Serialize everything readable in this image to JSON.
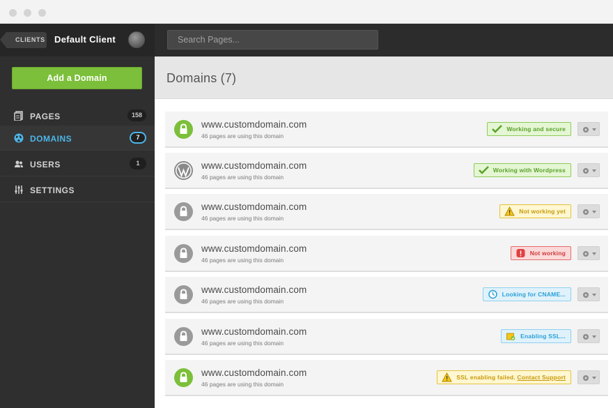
{
  "sidebar": {
    "back_label": "CLIENTS",
    "client_name": "Default Client",
    "add_domain_label": "Add a Domain",
    "nav": [
      {
        "label": "PAGES",
        "count": "158",
        "icon": "pages-icon"
      },
      {
        "label": "DOMAINS",
        "count": "7",
        "icon": "globe-icon"
      },
      {
        "label": "USERS",
        "count": "1",
        "icon": "users-icon"
      },
      {
        "label": "SETTINGS",
        "count": "",
        "icon": "sliders-icon"
      }
    ]
  },
  "topbar": {
    "search_placeholder": "Search Pages..."
  },
  "main": {
    "title": "Domains (7)",
    "domains": [
      {
        "name": "www.customdomain.com",
        "sub": "46 pages are using this domain",
        "icon": "lock-icon",
        "icon_color": "#7cbf3a",
        "status": "Working and secure",
        "status_link": "",
        "status_type": "green",
        "status_icon": "check-icon"
      },
      {
        "name": "www.customdomain.com",
        "sub": "46 pages are using this domain",
        "icon": "wordpress-icon",
        "icon_color": "#8a8a8a",
        "status": "Working with Wordpress",
        "status_link": "",
        "status_type": "green",
        "status_icon": "check-icon"
      },
      {
        "name": "www.customdomain.com",
        "sub": "46 pages are using this domain",
        "icon": "lock-icon",
        "icon_color": "#9a9a9a",
        "status": "Not working yet",
        "status_link": "",
        "status_type": "yellow",
        "status_icon": "warning-icon"
      },
      {
        "name": "www.customdomain.com",
        "sub": "46 pages are using this domain",
        "icon": "lock-icon",
        "icon_color": "#9a9a9a",
        "status": "Not working",
        "status_link": "",
        "status_type": "red",
        "status_icon": "error-icon"
      },
      {
        "name": "www.customdomain.com",
        "sub": "46 pages are using this domain",
        "icon": "lock-icon",
        "icon_color": "#9a9a9a",
        "status": "Looking for CNAME...",
        "status_link": "",
        "status_type": "blue",
        "status_icon": "clock-icon"
      },
      {
        "name": "www.customdomain.com",
        "sub": "46 pages are using this domain",
        "icon": "lock-icon",
        "icon_color": "#9a9a9a",
        "status": "Enabling SSL...",
        "status_link": "",
        "status_type": "blue",
        "status_icon": "ssl-icon"
      },
      {
        "name": "www.customdomain.com",
        "sub": "46 pages are using this domain",
        "icon": "lock-icon",
        "icon_color": "#7cbf3a",
        "status": "SSL enabling failed.",
        "status_link": "Contact Support",
        "status_type": "yellow",
        "status_icon": "warning-icon"
      }
    ]
  }
}
